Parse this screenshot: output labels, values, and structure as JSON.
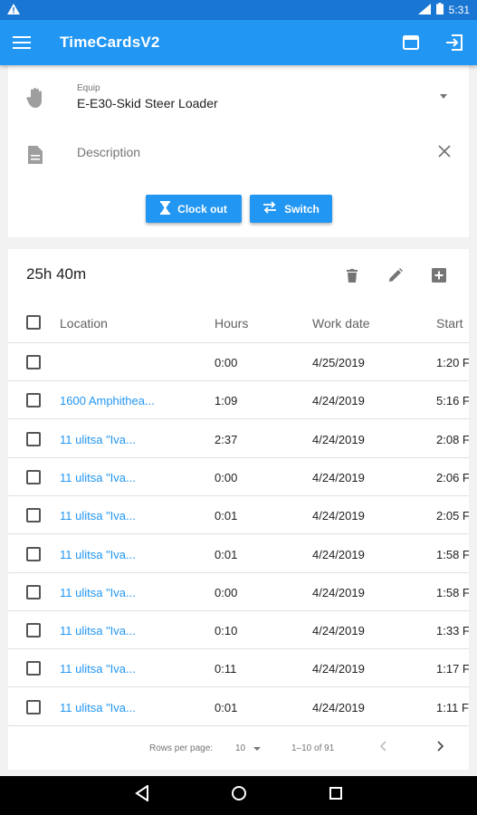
{
  "status_bar": {
    "time": "5:31",
    "warning_icon": "warning-icon",
    "signal_icon": "signal-icon",
    "battery_icon": "battery-icon"
  },
  "app_bar": {
    "title": "TimeCardsV2",
    "menu_icon": "menu-icon",
    "actions": [
      "window-icon",
      "exit-icon"
    ]
  },
  "form": {
    "equip_label": "Equip",
    "equip_value": "E-E30-Skid Steer Loader",
    "description_placeholder": "Description",
    "clock_out_label": "Clock out",
    "switch_label": "Switch"
  },
  "table": {
    "total": "25h 40m",
    "columns": [
      "Location",
      "Hours",
      "Work date",
      "Start"
    ],
    "rows": [
      {
        "location": "",
        "hours": "0:00",
        "date": "4/25/2019",
        "start": "1:20 F"
      },
      {
        "location": "1600 Amphithea...",
        "hours": "1:09",
        "date": "4/24/2019",
        "start": "5:16 F"
      },
      {
        "location": "11 ulitsa \"Iva...",
        "hours": "2:37",
        "date": "4/24/2019",
        "start": "2:08 F"
      },
      {
        "location": "11 ulitsa \"Iva...",
        "hours": "0:00",
        "date": "4/24/2019",
        "start": "2:06 F"
      },
      {
        "location": "11 ulitsa \"Iva...",
        "hours": "0:01",
        "date": "4/24/2019",
        "start": "2:05 F"
      },
      {
        "location": "11 ulitsa \"Iva...",
        "hours": "0:01",
        "date": "4/24/2019",
        "start": "1:58 F"
      },
      {
        "location": "11 ulitsa \"Iva...",
        "hours": "0:00",
        "date": "4/24/2019",
        "start": "1:58 F"
      },
      {
        "location": "11 ulitsa \"Iva...",
        "hours": "0:10",
        "date": "4/24/2019",
        "start": "1:33 F"
      },
      {
        "location": "11 ulitsa \"Iva...",
        "hours": "0:11",
        "date": "4/24/2019",
        "start": "1:17 F"
      },
      {
        "location": "11 ulitsa \"Iva...",
        "hours": "0:01",
        "date": "4/24/2019",
        "start": "1:11 F"
      }
    ]
  },
  "pager": {
    "rows_per_page_label": "Rows per page:",
    "rows_per_page_value": "10",
    "range": "1–10 of 91"
  },
  "colors": {
    "primary": "#2196f3",
    "status_bar": "#1976d2",
    "link": "#2196f3"
  }
}
